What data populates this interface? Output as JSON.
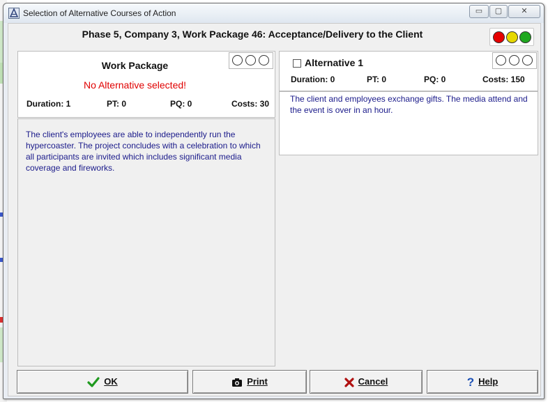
{
  "window": {
    "title": "Selection of Alternative Courses of Action",
    "controls": {
      "minimize": "▭",
      "maximize": "▢",
      "close": "✕"
    }
  },
  "header": {
    "title": "Phase 5, Company 3, Work Package 46: Acceptance/Delivery to the Client",
    "traffic_lights": [
      "#e60000",
      "#e6d800",
      "#1fa81f"
    ]
  },
  "work_package": {
    "title": "Work Package",
    "status": "No Alternative selected!",
    "duration": "Duration: 1",
    "pt": "PT: 0",
    "pq": "PQ: 0",
    "costs": "Costs: 30",
    "description": "The client's employees are able to independently run the hypercoaster. The project concludes with a celebration to which all participants are invited which includes significant media coverage and fireworks."
  },
  "alternative": {
    "title": "Alternative 1",
    "checked": false,
    "duration": "Duration: 0",
    "pt": "PT: 0",
    "pq": "PQ: 0",
    "costs": "Costs: 150",
    "description": "The client and employees exchange gifts. The media attend and the event is over in an hour."
  },
  "buttons": {
    "ok": "OK",
    "print": "Print",
    "cancel": "Cancel",
    "help": "Help"
  },
  "colors": {
    "status_red": "#e00000",
    "description_blue": "#1a1a8a",
    "ok_check_green": "#1f9a1f",
    "cancel_x_red": "#b01010",
    "help_blue": "#1a4fb5"
  }
}
